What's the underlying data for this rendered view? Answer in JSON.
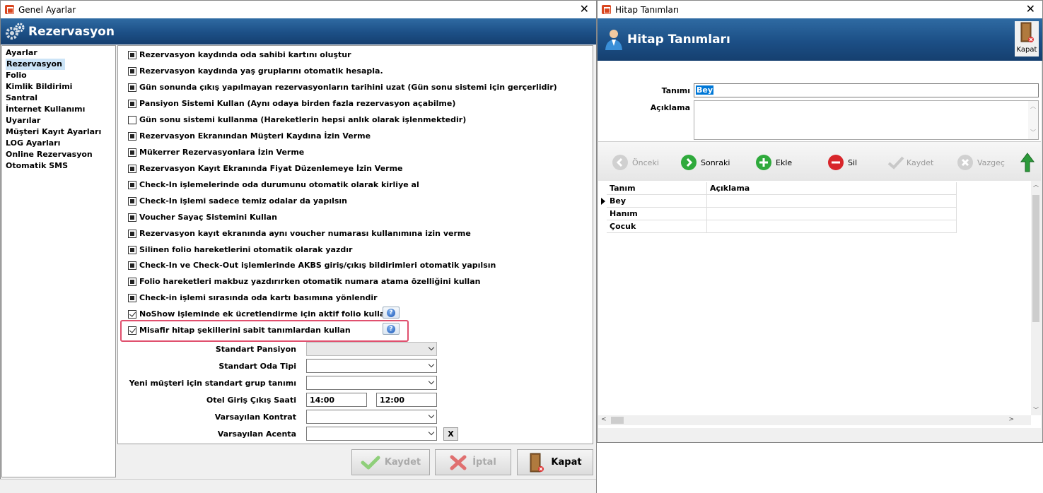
{
  "left_window": {
    "title": "Genel Ayarlar",
    "banner_title": "Rezervasyon",
    "nav_items": [
      "Ayarlar",
      "Rezervasyon",
      "Folio",
      "Kimlik Bildirimi",
      "Santral",
      "İnternet Kullanımı",
      "Uyarılar",
      "Müşteri Kayıt Ayarları",
      "LOG Ayarları",
      "Online Rezervasyon",
      "Otomatik SMS"
    ],
    "selected_nav": "Rezervasyon",
    "options": [
      {
        "label": "Rezervasyon kaydında oda sahibi kartını oluştur",
        "state": "indeterminate"
      },
      {
        "label": "Rezervasyon kaydında yaş gruplarını otomatik hesapla.",
        "state": "indeterminate"
      },
      {
        "label": "Gün sonunda çıkış yapılmayan rezervasyonların tarihini uzat (Gün sonu sistemi için gerçerlidir)",
        "state": "indeterminate"
      },
      {
        "label": "Pansiyon Sistemi Kullan (Aynı odaya birden fazla rezervasyon açabilme)",
        "state": "indeterminate"
      },
      {
        "label": "Gün sonu sistemi kullanma (Hareketlerin hepsi anlık olarak işlenmektedir)",
        "state": "unchecked"
      },
      {
        "label": "Rezervasyon Ekranından Müşteri Kaydına İzin Verme",
        "state": "indeterminate"
      },
      {
        "label": "Mükerrer Rezervasyonlara İzin Verme",
        "state": "indeterminate"
      },
      {
        "label": "Rezervasyon Kayıt Ekranında Fiyat Düzenlemeye İzin Verme",
        "state": "indeterminate"
      },
      {
        "label": "Check-In işlemelerinde oda durumunu otomatik olarak kirliye al",
        "state": "indeterminate"
      },
      {
        "label": "Check-In işlemi sadece temiz odalar da yapılsın",
        "state": "indeterminate"
      },
      {
        "label": "Voucher Sayaç Sistemini Kullan",
        "state": "indeterminate"
      },
      {
        "label": "Rezervasyon kayıt ekranında aynı voucher numarası kullanımına izin verme",
        "state": "indeterminate"
      },
      {
        "label": "Silinen folio hareketlerini otomatik olarak yazdır",
        "state": "indeterminate"
      },
      {
        "label": "Check-In ve Check-Out işlemlerinde AKBS giriş/çıkış bildirimleri otomatik yapılsın",
        "state": "indeterminate"
      },
      {
        "label": "Folio hareketleri makbuz yazdırırken otomatik numara atama özelliğini kullan",
        "state": "indeterminate"
      },
      {
        "label": "Check-in işlemi sırasında oda kartı basımına yönlendir",
        "state": "indeterminate"
      },
      {
        "label": "NoShow işleminde ek ücretlendirme için aktif folio kullan",
        "state": "checked"
      },
      {
        "label": "Misafir hitap şekillerini sabit tanımlardan kullan",
        "state": "checked"
      }
    ],
    "fields": {
      "standart_pansiyon": {
        "label": "Standart Pansiyon",
        "value": ""
      },
      "standart_oda_tipi": {
        "label": "Standart Oda Tipi",
        "value": ""
      },
      "yeni_musteri": {
        "label": "Yeni müşteri için standart grup tanımı",
        "value": ""
      },
      "giris_cikis": {
        "label": "Otel Giriş Çıkış Saati",
        "giris": "14:00",
        "cikis": "12:00"
      },
      "varsayilan_kontrat": {
        "label": "Varsayılan Kontrat",
        "value": ""
      },
      "varsayilan_acenta": {
        "label": "Varsayılan Acenta",
        "value": "",
        "clear": "X"
      }
    },
    "buttons": {
      "save": "Kaydet",
      "cancel": "İptal",
      "close": "Kapat"
    }
  },
  "right_window": {
    "title": "Hitap Tanımları",
    "banner_title": "Hitap Tanımları",
    "close_label": "Kapat",
    "form": {
      "tanim_label": "Tanımı",
      "tanim_value": "Bey",
      "aciklama_label": "Açıklama",
      "aciklama_value": ""
    },
    "toolbar": {
      "prev": "Önceki",
      "next": "Sonraki",
      "add": "Ekle",
      "delete": "Sil",
      "save": "Kaydet",
      "cancel": "Vazgeç"
    },
    "grid": {
      "columns": [
        "Tanım",
        "Açıklama"
      ],
      "rows": [
        [
          "Bey",
          ""
        ],
        [
          "Hanım",
          ""
        ],
        [
          "Çocuk",
          ""
        ]
      ]
    }
  },
  "colors": {
    "banner": "#1c4f86",
    "highlight": "#e0506e",
    "selection": "#0078d7"
  }
}
